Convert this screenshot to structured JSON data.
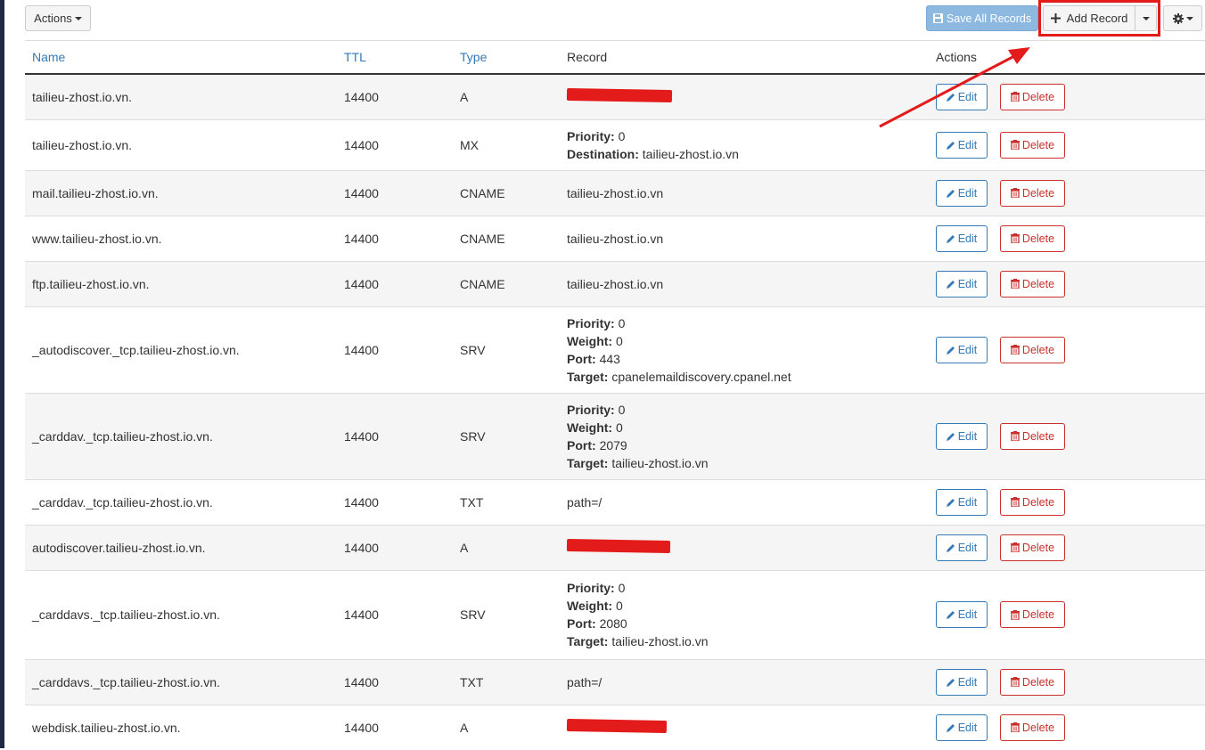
{
  "toolbar": {
    "actions_label": "Actions",
    "save_label": "Save All Records",
    "add_label": "Add Record",
    "gear_icon": "gear-icon"
  },
  "columns": {
    "name": "Name",
    "ttl": "TTL",
    "type": "Type",
    "record": "Record",
    "actions": "Actions"
  },
  "buttons": {
    "edit": "Edit",
    "delete": "Delete"
  },
  "records": [
    {
      "name": "tailieu-zhost.io.vn.",
      "ttl": "14400",
      "type": "A",
      "record_redacted": true
    },
    {
      "name": "tailieu-zhost.io.vn.",
      "ttl": "14400",
      "type": "MX",
      "fields": [
        {
          "label": "Priority:",
          "value": "0"
        },
        {
          "label": "Destination:",
          "value": "tailieu-zhost.io.vn"
        }
      ]
    },
    {
      "name": "mail.tailieu-zhost.io.vn.",
      "ttl": "14400",
      "type": "CNAME",
      "record": "tailieu-zhost.io.vn"
    },
    {
      "name": "www.tailieu-zhost.io.vn.",
      "ttl": "14400",
      "type": "CNAME",
      "record": "tailieu-zhost.io.vn"
    },
    {
      "name": "ftp.tailieu-zhost.io.vn.",
      "ttl": "14400",
      "type": "CNAME",
      "record": "tailieu-zhost.io.vn"
    },
    {
      "name": "_autodiscover._tcp.tailieu-zhost.io.vn.",
      "ttl": "14400",
      "type": "SRV",
      "fields": [
        {
          "label": "Priority:",
          "value": "0"
        },
        {
          "label": "Weight:",
          "value": "0"
        },
        {
          "label": "Port:",
          "value": "443"
        },
        {
          "label": "Target:",
          "value": "cpanelemaildiscovery.cpanel.net"
        }
      ]
    },
    {
      "name": "_carddav._tcp.tailieu-zhost.io.vn.",
      "ttl": "14400",
      "type": "SRV",
      "fields": [
        {
          "label": "Priority:",
          "value": "0"
        },
        {
          "label": "Weight:",
          "value": "0"
        },
        {
          "label": "Port:",
          "value": "2079"
        },
        {
          "label": "Target:",
          "value": "tailieu-zhost.io.vn"
        }
      ]
    },
    {
      "name": "_carddav._tcp.tailieu-zhost.io.vn.",
      "ttl": "14400",
      "type": "TXT",
      "record": "path=/"
    },
    {
      "name": "autodiscover.tailieu-zhost.io.vn.",
      "ttl": "14400",
      "type": "A",
      "record_redacted": true
    },
    {
      "name": "_carddavs._tcp.tailieu-zhost.io.vn.",
      "ttl": "14400",
      "type": "SRV",
      "fields": [
        {
          "label": "Priority:",
          "value": "0"
        },
        {
          "label": "Weight:",
          "value": "0"
        },
        {
          "label": "Port:",
          "value": "2080"
        },
        {
          "label": "Target:",
          "value": "tailieu-zhost.io.vn"
        }
      ]
    },
    {
      "name": "_carddavs._tcp.tailieu-zhost.io.vn.",
      "ttl": "14400",
      "type": "TXT",
      "record": "path=/"
    },
    {
      "name": "webdisk.tailieu-zhost.io.vn.",
      "ttl": "14400",
      "type": "A",
      "record_redacted": true
    }
  ],
  "annotation_color": "#e31b1b"
}
